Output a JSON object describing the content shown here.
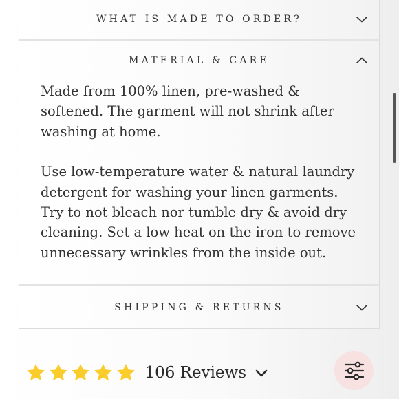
{
  "accordion": {
    "sections": [
      {
        "title": "WHAT IS MADE TO ORDER?",
        "state": "collapsed"
      },
      {
        "title": "MATERIAL & CARE",
        "state": "expanded",
        "paragraphs": [
          "Made from 100% linen, pre-washed & softened. The garment will not shrink after washing at home.",
          "Use low-temperature water & natural laundry detergent for washing your linen garments. Try to not bleach nor tumble dry & avoid dry cleaning. Set a low heat on the iron to remove unnecessary wrinkles from the inside out."
        ]
      },
      {
        "title": "SHIPPING & RETURNS",
        "state": "collapsed"
      }
    ]
  },
  "reviews": {
    "rating": 5,
    "max_rating": 5,
    "count_label": "106 Reviews"
  },
  "icons": {
    "collapsed_chevron": "chevron-down-icon",
    "expanded_chevron": "chevron-up-icon",
    "star": "star-icon",
    "filter": "sliders-icon"
  },
  "colors": {
    "star": "#FACD2D",
    "filter_button_bg": "#F7E1E1",
    "text": "#333333"
  }
}
